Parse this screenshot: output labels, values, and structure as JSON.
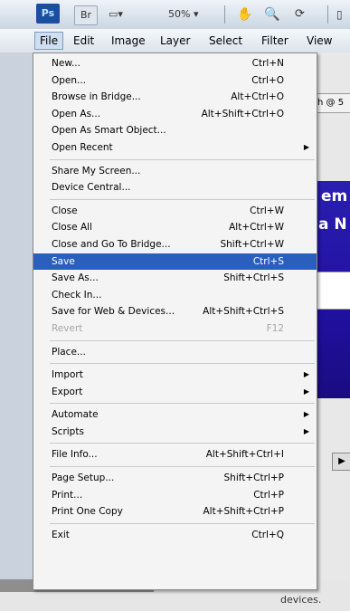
{
  "toolbar": {
    "ps_label": "Ps",
    "br_label": "Br",
    "zoom_value": "50%",
    "zoom_caret": "▾",
    "view_box_label": "▭▾"
  },
  "menubar": {
    "items": [
      "File",
      "Edit",
      "Image",
      "Layer",
      "Select",
      "Filter",
      "View"
    ]
  },
  "menu": {
    "items": [
      {
        "label": "New...",
        "shortcut": "Ctrl+N"
      },
      {
        "label": "Open...",
        "shortcut": "Ctrl+O"
      },
      {
        "label": "Browse in Bridge...",
        "shortcut": "Alt+Ctrl+O"
      },
      {
        "label": "Open As...",
        "shortcut": "Alt+Shift+Ctrl+O"
      },
      {
        "label": "Open As Smart Object...",
        "shortcut": ""
      },
      {
        "label": "Open Recent",
        "shortcut": "",
        "submenu": "▶"
      },
      {
        "label": "Share My Screen...",
        "shortcut": ""
      },
      {
        "label": "Device Central...",
        "shortcut": ""
      },
      {
        "label": "Close",
        "shortcut": "Ctrl+W"
      },
      {
        "label": "Close All",
        "shortcut": "Alt+Ctrl+W"
      },
      {
        "label": "Close and Go To Bridge...",
        "shortcut": "Shift+Ctrl+W"
      },
      {
        "label": "Save",
        "shortcut": "Ctrl+S"
      },
      {
        "label": "Save As...",
        "shortcut": "Shift+Ctrl+S"
      },
      {
        "label": "Check In...",
        "shortcut": ""
      },
      {
        "label": "Save for Web & Devices...",
        "shortcut": "Alt+Shift+Ctrl+S"
      },
      {
        "label": "Revert",
        "shortcut": "F12"
      },
      {
        "label": "Place...",
        "shortcut": ""
      },
      {
        "label": "Import",
        "shortcut": "",
        "submenu": "▶"
      },
      {
        "label": "Export",
        "shortcut": "",
        "submenu": "▶"
      },
      {
        "label": "Automate",
        "shortcut": "",
        "submenu": "▶"
      },
      {
        "label": "Scripts",
        "shortcut": "",
        "submenu": "▶"
      },
      {
        "label": "File Info...",
        "shortcut": "Alt+Shift+Ctrl+I"
      },
      {
        "label": "Page Setup...",
        "shortcut": "Shift+Ctrl+P"
      },
      {
        "label": "Print...",
        "shortcut": "Ctrl+P"
      },
      {
        "label": "Print One Copy",
        "shortcut": "Alt+Shift+Ctrl+P"
      },
      {
        "label": "Exit",
        "shortcut": "Ctrl+Q"
      }
    ]
  },
  "document": {
    "tab_fragment": "h @ 5",
    "banner_line1": "em",
    "banner_line2": "a N",
    "scroll_arrow": "▶",
    "caption": "devices."
  }
}
